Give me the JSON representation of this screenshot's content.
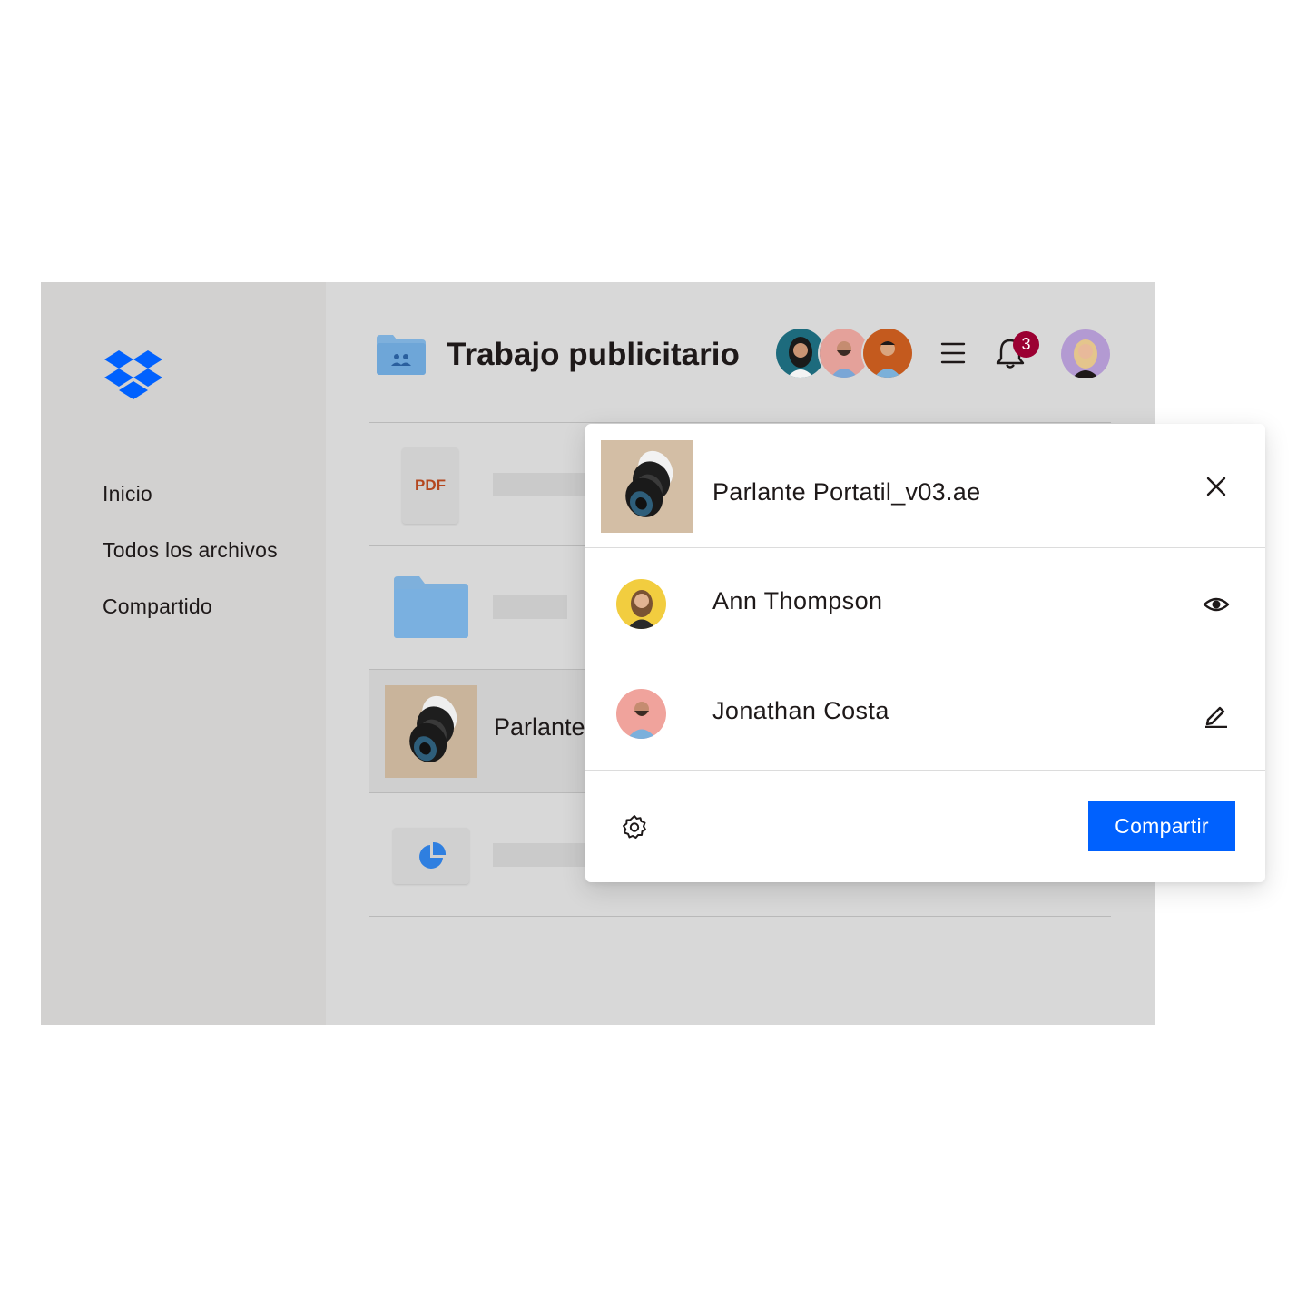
{
  "sidebar": {
    "logo_icon": "dropbox-logo-icon",
    "items": [
      {
        "label": "Inicio"
      },
      {
        "label": "Todos los archivos"
      },
      {
        "label": "Compartido"
      }
    ]
  },
  "header": {
    "folder_icon": "shared-folder-icon",
    "title": "Trabajo publicitario",
    "member_avatars": [
      "member-avatar-1",
      "member-avatar-2",
      "member-avatar-3"
    ],
    "menu_icon": "menu-icon",
    "notifications": {
      "icon": "bell-icon",
      "count": "3"
    },
    "user_avatar": "user-avatar"
  },
  "file_list": {
    "rows": [
      {
        "type_label": "PDF",
        "icon": "pdf-icon"
      },
      {
        "icon": "folder-icon"
      },
      {
        "name": "Parlante",
        "icon": "speaker-thumbnail",
        "selected": true
      },
      {
        "icon": "pie-chart-icon"
      }
    ]
  },
  "share_panel": {
    "file_name": "Parlante Portatil_v03.ae",
    "close_icon": "close-icon",
    "members": [
      {
        "name": "Ann Thompson",
        "permission_icon": "eye-icon",
        "permission": "view"
      },
      {
        "name": "Jonathan Costa",
        "permission_icon": "pencil-icon",
        "permission": "edit"
      }
    ],
    "settings_icon": "gear-icon",
    "share_label": "Compartir"
  },
  "colors": {
    "accent": "#0061fe",
    "logo_blue": "#0061fe",
    "badge": "#9b0032",
    "sidebar_bg": "#d2d1d0",
    "app_bg": "#d8d8d8",
    "pdf_label": "#b4471f",
    "folder_blue": "#7eb0dc"
  }
}
